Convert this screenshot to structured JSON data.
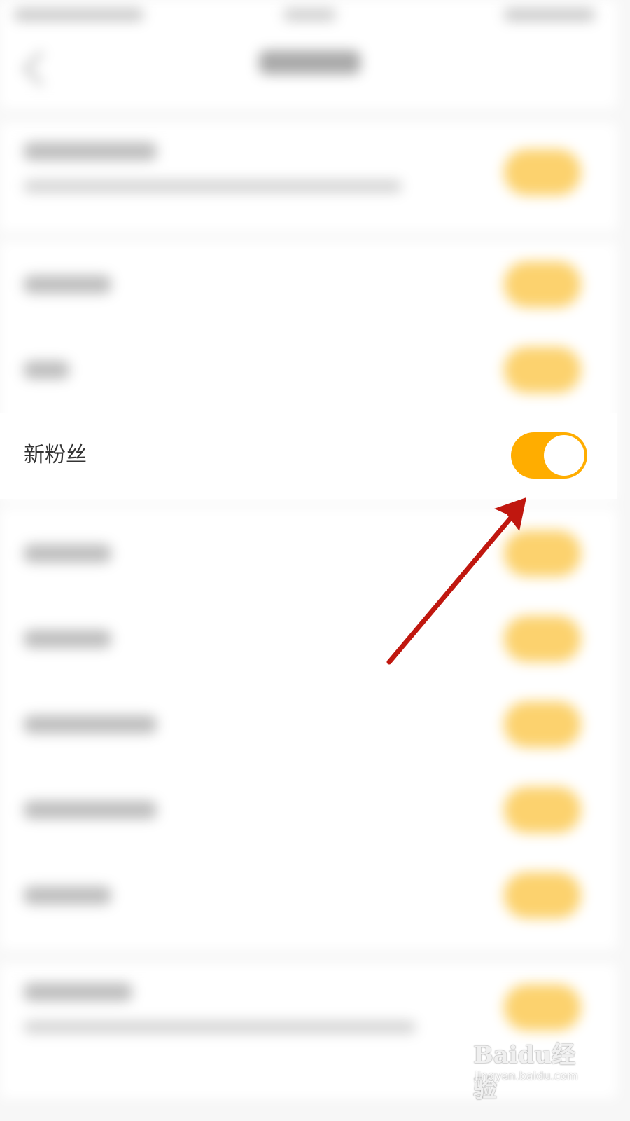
{
  "focus_row": {
    "label": "新粉丝",
    "toggle_on": true
  },
  "colors": {
    "toggle_on": "#ffad00",
    "annotation_arrow": "#c0170f",
    "background": "#f7f7f7"
  },
  "watermark": {
    "brand": "Baidu经验",
    "url": "jingyan.baidu.com"
  }
}
